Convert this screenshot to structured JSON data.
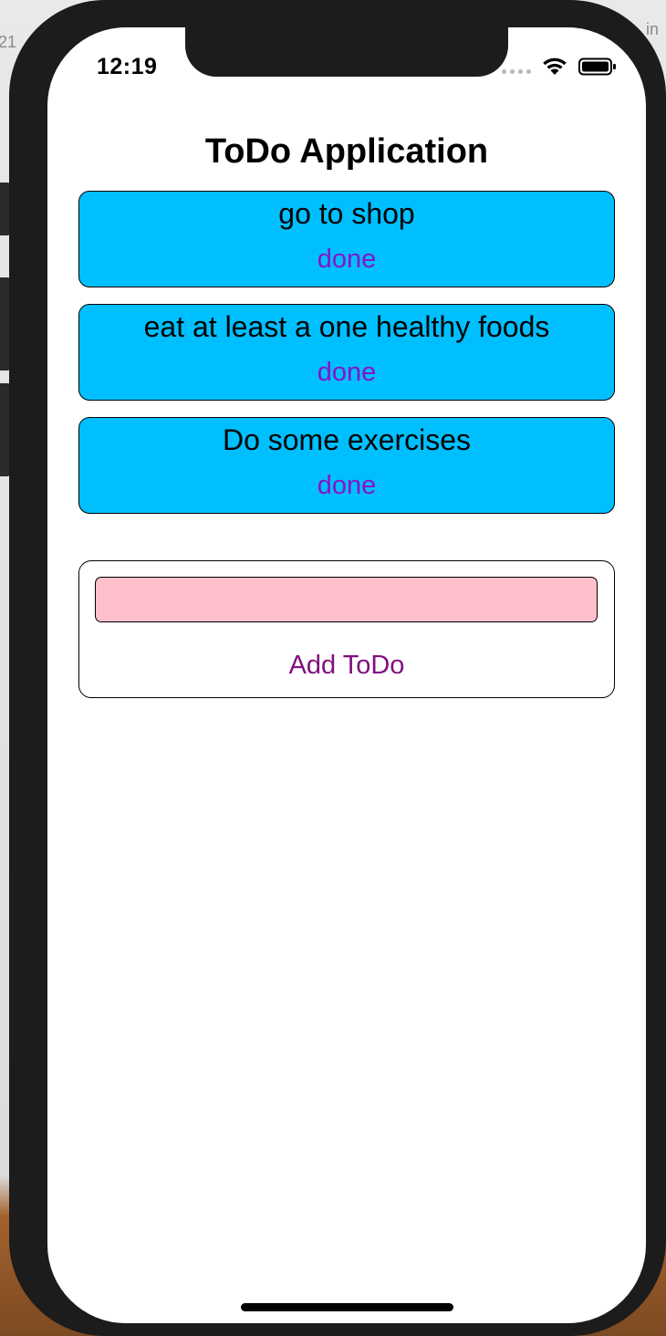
{
  "status_bar": {
    "time": "12:19"
  },
  "app": {
    "title": "ToDo Application"
  },
  "todos": [
    {
      "text": "go to shop",
      "done_label": "done"
    },
    {
      "text": "eat at least a one healthy foods",
      "done_label": "done"
    },
    {
      "text": "Do some exercises",
      "done_label": "done"
    }
  ],
  "add_form": {
    "input_value": "",
    "add_label": "Add ToDo"
  },
  "colors": {
    "todo_background": "#00bfff",
    "done_text": "#8515c7",
    "input_background": "#ffc0cb",
    "add_text": "#80107f"
  },
  "icons": [
    "signal-icon",
    "wifi-icon",
    "battery-icon"
  ]
}
